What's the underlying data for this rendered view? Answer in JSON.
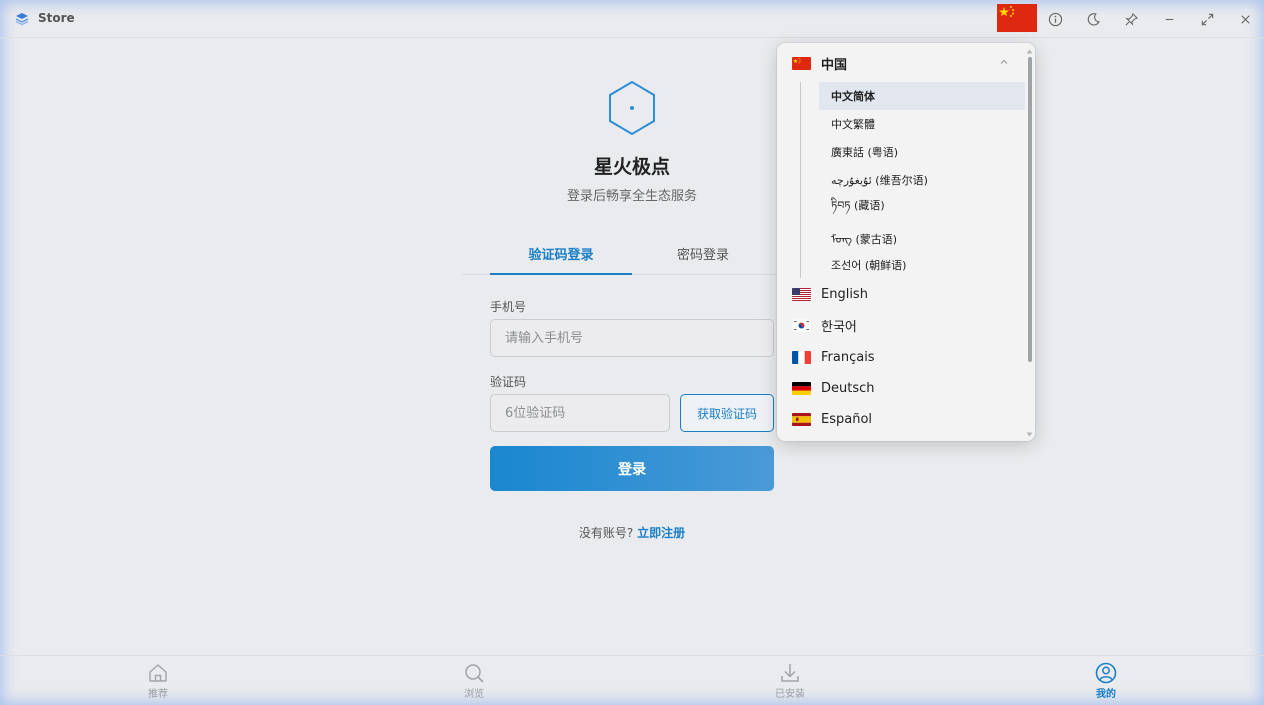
{
  "titlebar": {
    "app_title": "Store",
    "icons": [
      "store-logo-icon",
      "china-flag-icon",
      "info-icon",
      "moon-icon",
      "pin-icon",
      "minimize-icon",
      "maximize-icon",
      "close-icon"
    ]
  },
  "login": {
    "brand": "星火极点",
    "subtitle": "登录后畅享全生态服务",
    "tabs": [
      {
        "label": "验证码登录",
        "active": true
      },
      {
        "label": "密码登录",
        "active": false
      }
    ],
    "phone_label": "手机号",
    "phone_placeholder": "请输入手机号",
    "code_label": "验证码",
    "code_placeholder": "6位验证码",
    "get_code_label": "获取验证码",
    "login_label": "登录",
    "no_account_text": "没有账号?",
    "register_link": "立即注册"
  },
  "bottom_nav": [
    {
      "label": "推荐",
      "icon": "home-icon",
      "active": false
    },
    {
      "label": "浏览",
      "icon": "search-icon",
      "active": false
    },
    {
      "label": "已安装",
      "icon": "download-icon",
      "active": false
    },
    {
      "label": "我的",
      "icon": "user-icon",
      "active": true
    }
  ],
  "language_menu": {
    "group": {
      "label": "中国",
      "icon": "china-flag-icon",
      "expanded": true
    },
    "group_items": [
      {
        "label": "中文简体",
        "selected": true
      },
      {
        "label": "中文繁體",
        "selected": false
      },
      {
        "label": "廣東話 (粤语)",
        "selected": false
      },
      {
        "label": "ئۇيغۇرچە (维吾尔语)",
        "selected": false
      },
      {
        "label": "ཏིབཏ (藏语)",
        "selected": false
      },
      {
        "label": "ᠮᠣᠩ (蒙古语)",
        "selected": false
      },
      {
        "label": "조선어 (朝鲜语)",
        "selected": false
      }
    ],
    "languages": [
      {
        "label": "English",
        "icon": "us-flag-icon"
      },
      {
        "label": "한국어",
        "icon": "korea-flag-icon"
      },
      {
        "label": "Français",
        "icon": "france-flag-icon"
      },
      {
        "label": "Deutsch",
        "icon": "germany-flag-icon"
      },
      {
        "label": "Español",
        "icon": "spain-flag-icon"
      }
    ]
  },
  "colors": {
    "accent": "#1a7fc7",
    "background": "#e9ebee",
    "dropdown_bg": "#f3f3f4",
    "selected_bg": "#e1e6ef"
  }
}
